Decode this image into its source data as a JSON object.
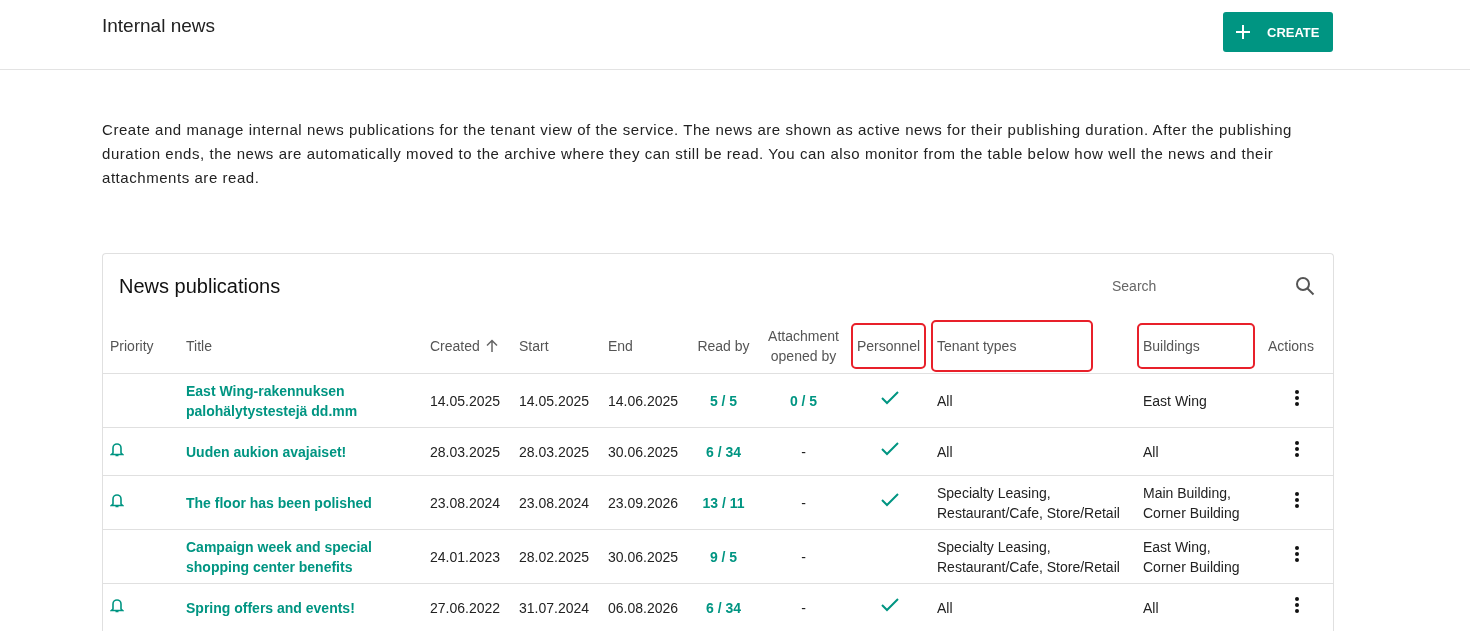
{
  "header": {
    "title": "Internal news",
    "create_button": "CREATE"
  },
  "description": "Create and manage internal news publications for the tenant view of the service. The news are shown as active news for their publishing duration. After the publishing duration ends, the news are automatically moved to the archive where they can still be read. You can also monitor from the table below how well the news and their attachments are read.",
  "table": {
    "title": "News publications",
    "search": {
      "placeholder": "Search"
    },
    "columns": [
      {
        "label": "Priority",
        "highlighted": false,
        "sorted": false
      },
      {
        "label": "Title",
        "highlighted": false,
        "sorted": false
      },
      {
        "label": "Created",
        "highlighted": false,
        "sorted": true
      },
      {
        "label": "Start",
        "highlighted": false,
        "sorted": false
      },
      {
        "label": "End",
        "highlighted": false,
        "sorted": false
      },
      {
        "label": "Read by",
        "highlighted": false,
        "sorted": false
      },
      {
        "label": "Attachment opened by",
        "highlighted": false,
        "sorted": false
      },
      {
        "label": "Personnel",
        "highlighted": true,
        "sorted": false
      },
      {
        "label": "Tenant types",
        "highlighted": true,
        "sorted": false
      },
      {
        "label": "Buildings",
        "highlighted": true,
        "sorted": false
      },
      {
        "label": "Actions",
        "highlighted": false,
        "sorted": false
      }
    ],
    "rows": [
      {
        "priority": false,
        "title": "East Wing-rakennuksen palohälytystestejä dd.mm",
        "created": "14.05.2025",
        "start": "14.05.2025",
        "end": "14.06.2025",
        "read_by": "5 / 5",
        "attachment_opened_by": "0 / 5",
        "attachment_link": true,
        "personnel": true,
        "tenant_types": "All",
        "buildings": "East Wing"
      },
      {
        "priority": true,
        "title": "Uuden aukion avajaiset!",
        "created": "28.03.2025",
        "start": "28.03.2025",
        "end": "30.06.2025",
        "read_by": "6 / 34",
        "attachment_opened_by": "-",
        "attachment_link": false,
        "personnel": true,
        "tenant_types": "All",
        "buildings": "All"
      },
      {
        "priority": true,
        "title": "The floor has been polished",
        "created": "23.08.2024",
        "start": "23.08.2024",
        "end": "23.09.2026",
        "read_by": "13 / 11",
        "attachment_opened_by": "-",
        "attachment_link": false,
        "personnel": true,
        "tenant_types": "Specialty Leasing, Restaurant/Cafe, Store/Retail",
        "buildings": "Main Building, Corner Building"
      },
      {
        "priority": false,
        "title": "Campaign week and special shopping center benefits",
        "created": "24.01.2023",
        "start": "28.02.2025",
        "end": "30.06.2025",
        "read_by": "9 / 5",
        "attachment_opened_by": "-",
        "attachment_link": false,
        "personnel": false,
        "tenant_types": "Specialty Leasing, Restaurant/Cafe, Store/Retail",
        "buildings": "East Wing, Corner Building"
      },
      {
        "priority": true,
        "title": "Spring offers and events!",
        "created": "27.06.2022",
        "start": "31.07.2024",
        "end": "06.08.2026",
        "read_by": "6 / 34",
        "attachment_opened_by": "-",
        "attachment_link": false,
        "personnel": true,
        "tenant_types": "All",
        "buildings": "All"
      }
    ]
  }
}
